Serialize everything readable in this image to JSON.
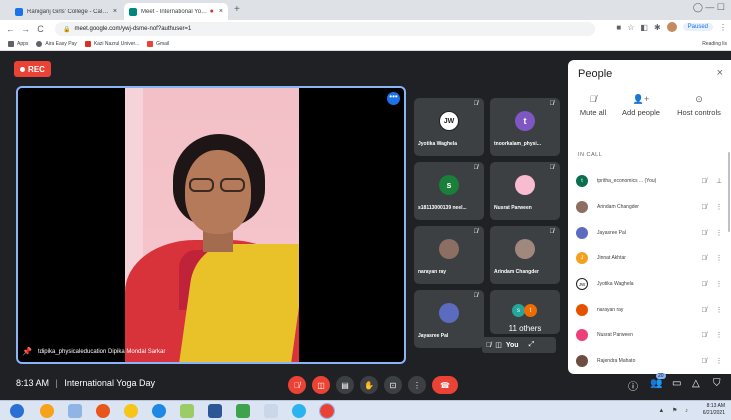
{
  "browser": {
    "tabs": [
      {
        "label": "Raniganj Girls' College - Calenda",
        "close": "×"
      },
      {
        "label": "Meet - International Yoga D",
        "close": "×"
      }
    ],
    "new_tab": "+",
    "window_controls": "◯  —  ☐",
    "url": "meet.google.com/ywj-dsme-nof?authuser=1",
    "profile_status": "Paused",
    "bookmarks": [
      "Apps",
      "Aira Easy Pay",
      "Kazi Nazrul Univer...",
      "Gmail"
    ],
    "reading_list": "Reading lis"
  },
  "meet": {
    "rec_label": "REC",
    "main_speaker": "tdipika_physicaleducation Dipika Mondal Sarkar",
    "tiles": [
      {
        "name": "Jyotika Waghela",
        "initials": "JW",
        "color": "#ffffff"
      },
      {
        "name": "tnoorkalam_physi...",
        "initials": "t",
        "color": "#7e57c2"
      },
      {
        "name": "s18113000139 neel...",
        "initials": "s",
        "color": "#188038"
      },
      {
        "name": "Nusrat Parween",
        "initials": "",
        "color": "#f8bbd0"
      },
      {
        "name": "narayan ray",
        "initials": "",
        "color": "#8d6e63"
      },
      {
        "name": "Arindam Changder",
        "initials": "",
        "color": "#a1887f"
      },
      {
        "name": "Jayasree Pal",
        "initials": "",
        "color": "#5c6bc0"
      }
    ],
    "others_label": "11 others",
    "others_avatars": [
      "s",
      "t"
    ],
    "you_label": "You",
    "time": "8:13 AM",
    "separator": "|",
    "meeting_title": "International Yoga Day",
    "participant_count": "20"
  },
  "people": {
    "title": "People",
    "close": "×",
    "actions": [
      {
        "label": "Mute all",
        "icon": "mic-off-icon"
      },
      {
        "label": "Add people",
        "icon": "person-add-icon"
      },
      {
        "label": "Host controls",
        "icon": "toggle-icon"
      }
    ],
    "section": "IN CALL",
    "participants": [
      {
        "name": "tpritha_economics ... (You)",
        "initial": "t",
        "color": "#0b6e4f"
      },
      {
        "name": "Arindam Changder",
        "initial": "",
        "color": "#8d6e63"
      },
      {
        "name": "Jayasree Pal",
        "initial": "",
        "color": "#5c6bc0"
      },
      {
        "name": "Jinnat Akhtar",
        "initial": "J",
        "color": "#f4a11f"
      },
      {
        "name": "Jyotika Waghela",
        "initial": "JW",
        "color": "#ffffff"
      },
      {
        "name": "narayan ray",
        "initial": "",
        "color": "#e65100"
      },
      {
        "name": "Nusrat Parween",
        "initial": "",
        "color": "#ec407a"
      },
      {
        "name": "Rajendra Mahato",
        "initial": "",
        "color": "#6d4c41"
      }
    ]
  },
  "taskbar": {
    "time": "8:13 AM",
    "date": "6/21/2021"
  },
  "colors": {
    "accent": "#1a73e8",
    "danger": "#ea4335",
    "meet_bg": "#202124"
  }
}
